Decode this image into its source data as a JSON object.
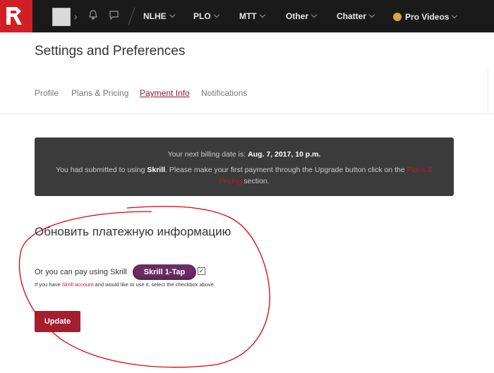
{
  "nav": {
    "items": [
      {
        "label": "NLHE"
      },
      {
        "label": "PLO"
      },
      {
        "label": "MTT"
      },
      {
        "label": "Other"
      },
      {
        "label": "Chatter"
      },
      {
        "label": "Pro Videos"
      }
    ],
    "icons": [
      "logo-icon",
      "avatar",
      "chevron-right-icon",
      "bell-icon",
      "chat-icon",
      "crown-icon"
    ]
  },
  "page": {
    "title": "Settings and Preferences",
    "tabs": [
      {
        "label": "Profile",
        "active": false
      },
      {
        "label": "Plans & Pricing",
        "active": false
      },
      {
        "label": "Payment Info",
        "active": true
      },
      {
        "label": "Notifications",
        "active": false
      }
    ]
  },
  "notice": {
    "line1_prefix": "Your next billing date is:",
    "billing_date": "Aug. 7, 2017, 10 p.m.",
    "line2_prefix": "You had submitted to using",
    "method": "Skrill",
    "line2_middle": ". Please make your first payment through the Upgrade button click on the",
    "link": "Plans & Pricing",
    "line2_suffix": "section."
  },
  "update_section": {
    "title": "Обновить платежную информацию",
    "pay_text": "Or you can pay using Skrill",
    "skrill_button": "Skrill 1-Tap",
    "checkbox_checked": true,
    "hint_prefix": "If you have",
    "hint_link": "Skrill account",
    "hint_suffix": "and would like to use it, select the checkbox above.",
    "update_button": "Update"
  },
  "colors": {
    "topbar": "#1a1a1a",
    "brand_red": "#d11f26",
    "active_tab": "#8b1a2a",
    "notice_bg": "#3b3b3b",
    "skrill_purple": "#6b2c63",
    "button_red": "#a11f2e",
    "annotation_red": "#e10000"
  }
}
